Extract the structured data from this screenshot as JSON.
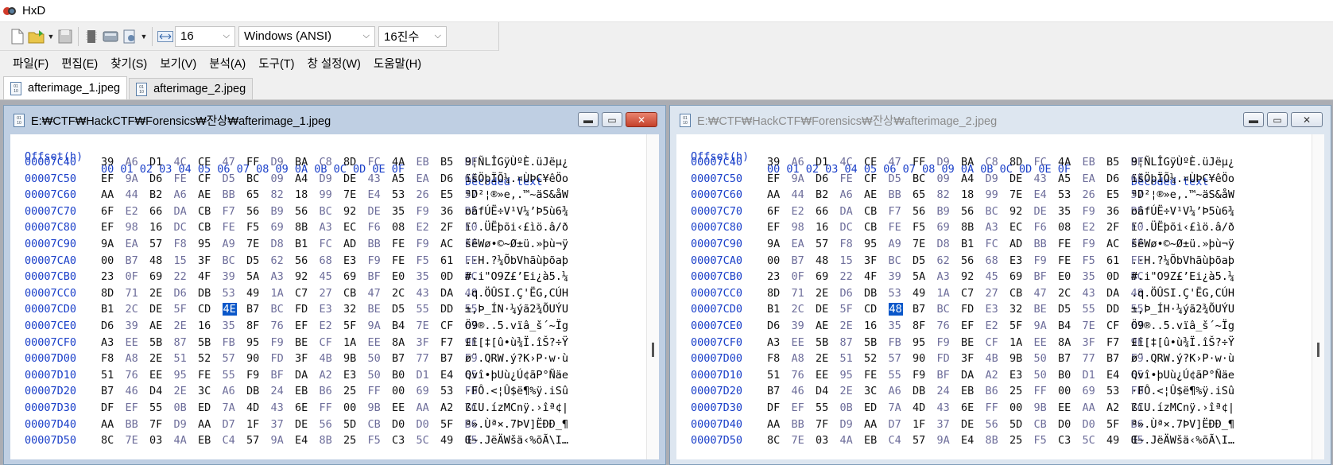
{
  "app": {
    "title": "HxD"
  },
  "toolbar": {
    "bytes_per_row": "16",
    "charset": "Windows (ANSI)",
    "offset_base": "16진수"
  },
  "menu": [
    "파일(F)",
    "편집(E)",
    "찾기(S)",
    "보기(V)",
    "분석(A)",
    "도구(T)",
    "창 설정(W)",
    "도움말(H)"
  ],
  "tabs": [
    {
      "label": "afterimage_1.jpeg"
    },
    {
      "label": "afterimage_2.jpeg"
    }
  ],
  "header": {
    "offset": "Offset(h)",
    "columns": "00 01 02 03 04 05 06 07 08 09 0A 0B 0C 0D 0E 0F",
    "decoded": "Decoded text"
  },
  "windows": [
    {
      "path": "E:₩CTF₩HackCTF₩Forensics₩잔상₩afterimage_1.jpeg",
      "selected_row": 9,
      "selected_col": 5,
      "rows": [
        {
          "offset": "00007C40",
          "bytes": [
            "39",
            "A6",
            "D1",
            "4C",
            "CE",
            "47",
            "FF",
            "D9",
            "BA",
            "C8",
            "8D",
            "FC",
            "4A",
            "EB",
            "B5",
            "BF"
          ],
          "text": "9¦ÑLÎGÿÙºÈ.üJëµ¿"
        },
        {
          "offset": "00007C50",
          "bytes": [
            "EF",
            "9A",
            "D6",
            "FE",
            "CF",
            "D5",
            "BC",
            "09",
            "A4",
            "D9",
            "DE",
            "43",
            "A5",
            "EA",
            "D6",
            "6F"
          ],
          "text": "ïšÖþÏÕ¼.¤ÙÞC¥êÖo"
        },
        {
          "offset": "00007C60",
          "bytes": [
            "AA",
            "44",
            "B2",
            "A6",
            "AE",
            "BB",
            "65",
            "82",
            "18",
            "99",
            "7E",
            "E4",
            "53",
            "26",
            "E5",
            "57"
          ],
          "text": "ªD²¦®»e‚.™~äS&åW"
        },
        {
          "offset": "00007C70",
          "bytes": [
            "6F",
            "E2",
            "66",
            "DA",
            "CB",
            "F7",
            "56",
            "B9",
            "56",
            "BC",
            "92",
            "DE",
            "35",
            "F9",
            "36",
            "BE"
          ],
          "text": "oâfÚË÷V¹V¼’Þ5ù6¾"
        },
        {
          "offset": "00007C80",
          "bytes": [
            "EF",
            "98",
            "16",
            "DC",
            "CB",
            "FE",
            "F5",
            "69",
            "8B",
            "A3",
            "EC",
            "F6",
            "08",
            "E2",
            "2F",
            "F0"
          ],
          "text": "ï˜.ÜËþõi‹£ìö.â/ð"
        },
        {
          "offset": "00007C90",
          "bytes": [
            "9A",
            "EA",
            "57",
            "F8",
            "95",
            "A9",
            "7E",
            "D8",
            "B1",
            "FC",
            "AD",
            "BB",
            "FE",
            "F9",
            "AC",
            "FF"
          ],
          "text": "šêWø•©~Ø±ü.»þù¬ÿ"
        },
        {
          "offset": "00007CA0",
          "bytes": [
            "00",
            "B7",
            "48",
            "15",
            "3F",
            "BC",
            "D5",
            "62",
            "56",
            "68",
            "E3",
            "F9",
            "FE",
            "F5",
            "61",
            "FE"
          ],
          "text": ".·H.?¼ÕbVhãùþõaþ"
        },
        {
          "offset": "00007CB0",
          "bytes": [
            "23",
            "0F",
            "69",
            "22",
            "4F",
            "39",
            "5A",
            "A3",
            "92",
            "45",
            "69",
            "BF",
            "E0",
            "35",
            "0D",
            "BC"
          ],
          "text": "#.i\"O9Z£’Ei¿à5.¼"
        },
        {
          "offset": "00007CC0",
          "bytes": [
            "8D",
            "71",
            "2E",
            "D6",
            "DB",
            "53",
            "49",
            "1A",
            "C7",
            "27",
            "CB",
            "47",
            "2C",
            "43",
            "DA",
            "48"
          ],
          "text": ".q.ÖÛSI.Ç'ËG,CÚH"
        },
        {
          "offset": "00007CD0",
          "bytes": [
            "B1",
            "2C",
            "DE",
            "5F",
            "CD",
            "4E",
            "B7",
            "BC",
            "FD",
            "E3",
            "32",
            "BE",
            "D5",
            "55",
            "DD",
            "55"
          ],
          "text": "±,Þ_ÍN·¼ýã2¾ÕUÝU"
        },
        {
          "offset": "00007CE0",
          "bytes": [
            "D6",
            "39",
            "AE",
            "2E",
            "16",
            "35",
            "8F",
            "76",
            "EF",
            "E2",
            "5F",
            "9A",
            "B4",
            "7E",
            "CF",
            "67"
          ],
          "text": "Ö9®..5.vïâ_š´~Ïg"
        },
        {
          "offset": "00007CF0",
          "bytes": [
            "A3",
            "EE",
            "5B",
            "87",
            "5B",
            "FB",
            "95",
            "F9",
            "BE",
            "CF",
            "1A",
            "EE",
            "8A",
            "3F",
            "F7",
            "9F"
          ],
          "text": "£î[‡[û•ù¾Ï.îŠ?÷Ÿ"
        },
        {
          "offset": "00007D00",
          "bytes": [
            "F8",
            "A8",
            "2E",
            "51",
            "52",
            "57",
            "90",
            "FD",
            "3F",
            "4B",
            "9B",
            "50",
            "B7",
            "77",
            "B7",
            "F9"
          ],
          "text": "ø¨.QRW.ý?K›P·w·ù"
        },
        {
          "offset": "00007D10",
          "bytes": [
            "51",
            "76",
            "EE",
            "95",
            "FE",
            "55",
            "F9",
            "BF",
            "DA",
            "A2",
            "E3",
            "50",
            "B0",
            "D1",
            "E4",
            "65"
          ],
          "text": "Qvî•þUù¿Ú¢ãP°Ñäe"
        },
        {
          "offset": "00007D20",
          "bytes": [
            "B7",
            "46",
            "D4",
            "2E",
            "3C",
            "A6",
            "DB",
            "24",
            "EB",
            "B6",
            "25",
            "FF",
            "00",
            "69",
            "53",
            "FB"
          ],
          "text": "·FÔ.<¦Û$ë¶%ÿ.iSû"
        },
        {
          "offset": "00007D30",
          "bytes": [
            "DF",
            "EF",
            "55",
            "0B",
            "ED",
            "7A",
            "4D",
            "43",
            "6E",
            "FF",
            "00",
            "9B",
            "EE",
            "AA",
            "A2",
            "7C"
          ],
          "text": "ßïU.ízMCnÿ.›îª¢|"
        },
        {
          "offset": "00007D40",
          "bytes": [
            "AA",
            "BB",
            "7F",
            "D9",
            "AA",
            "D7",
            "1F",
            "37",
            "DE",
            "56",
            "5D",
            "CB",
            "D0",
            "D0",
            "5F",
            "B6"
          ],
          "text": "ª».Ùª×.7ÞV]ËÐÐ_¶"
        },
        {
          "offset": "00007D50",
          "bytes": [
            "8C",
            "7E",
            "03",
            "4A",
            "EB",
            "C4",
            "57",
            "9A",
            "E4",
            "8B",
            "25",
            "F5",
            "C3",
            "5C",
            "49",
            "85"
          ],
          "text": "Œ~.JëÄWšä‹%õÃ\\I…"
        }
      ]
    },
    {
      "path": "E:₩CTF₩HackCTF₩Forensics₩잔상₩afterimage_2.jpeg",
      "selected_row": 9,
      "selected_col": 5,
      "rows": [
        {
          "offset": "00007C40",
          "bytes": [
            "39",
            "A6",
            "D1",
            "4C",
            "CE",
            "47",
            "FF",
            "D9",
            "BA",
            "C8",
            "8D",
            "FC",
            "4A",
            "EB",
            "B5",
            "BF"
          ],
          "text": "9¦ÑLÎGÿÙºÈ.üJëµ¿"
        },
        {
          "offset": "00007C50",
          "bytes": [
            "EF",
            "9A",
            "D6",
            "FE",
            "CF",
            "D5",
            "BC",
            "09",
            "A4",
            "D9",
            "DE",
            "43",
            "A5",
            "EA",
            "D6",
            "6F"
          ],
          "text": "ïšÖþÏÕ¼.¤ÙÞC¥êÖo"
        },
        {
          "offset": "00007C60",
          "bytes": [
            "AA",
            "44",
            "B2",
            "A6",
            "AE",
            "BB",
            "65",
            "82",
            "18",
            "99",
            "7E",
            "E4",
            "53",
            "26",
            "E5",
            "57"
          ],
          "text": "ªD²¦®»e‚.™~äS&åW"
        },
        {
          "offset": "00007C70",
          "bytes": [
            "6F",
            "E2",
            "66",
            "DA",
            "CB",
            "F7",
            "56",
            "B9",
            "56",
            "BC",
            "92",
            "DE",
            "35",
            "F9",
            "36",
            "BE"
          ],
          "text": "oâfÚË÷V¹V¼’Þ5ù6¾"
        },
        {
          "offset": "00007C80",
          "bytes": [
            "EF",
            "98",
            "16",
            "DC",
            "CB",
            "FE",
            "F5",
            "69",
            "8B",
            "A3",
            "EC",
            "F6",
            "08",
            "E2",
            "2F",
            "F0"
          ],
          "text": "ï˜.ÜËþõi‹£ìö.â/ð"
        },
        {
          "offset": "00007C90",
          "bytes": [
            "9A",
            "EA",
            "57",
            "F8",
            "95",
            "A9",
            "7E",
            "D8",
            "B1",
            "FC",
            "AD",
            "BB",
            "FE",
            "F9",
            "AC",
            "FF"
          ],
          "text": "šêWø•©~Ø±ü.»þù¬ÿ"
        },
        {
          "offset": "00007CA0",
          "bytes": [
            "00",
            "B7",
            "48",
            "15",
            "3F",
            "BC",
            "D5",
            "62",
            "56",
            "68",
            "E3",
            "F9",
            "FE",
            "F5",
            "61",
            "FE"
          ],
          "text": ".·H.?¼ÕbVhãùþõaþ"
        },
        {
          "offset": "00007CB0",
          "bytes": [
            "23",
            "0F",
            "69",
            "22",
            "4F",
            "39",
            "5A",
            "A3",
            "92",
            "45",
            "69",
            "BF",
            "E0",
            "35",
            "0D",
            "BC"
          ],
          "text": "#.i\"O9Z£’Ei¿à5.¼"
        },
        {
          "offset": "00007CC0",
          "bytes": [
            "8D",
            "71",
            "2E",
            "D6",
            "DB",
            "53",
            "49",
            "1A",
            "C7",
            "27",
            "CB",
            "47",
            "2C",
            "43",
            "DA",
            "48"
          ],
          "text": ".q.ÖÛSI.Ç'ËG,CÚH"
        },
        {
          "offset": "00007CD0",
          "bytes": [
            "B1",
            "2C",
            "DE",
            "5F",
            "CD",
            "48",
            "B7",
            "BC",
            "FD",
            "E3",
            "32",
            "BE",
            "D5",
            "55",
            "DD",
            "55"
          ],
          "text": "±,Þ_ÍH·¼ýã2¾ÕUÝU"
        },
        {
          "offset": "00007CE0",
          "bytes": [
            "D6",
            "39",
            "AE",
            "2E",
            "16",
            "35",
            "8F",
            "76",
            "EF",
            "E2",
            "5F",
            "9A",
            "B4",
            "7E",
            "CF",
            "67"
          ],
          "text": "Ö9®..5.vïâ_š´~Ïg"
        },
        {
          "offset": "00007CF0",
          "bytes": [
            "A3",
            "EE",
            "5B",
            "87",
            "5B",
            "FB",
            "95",
            "F9",
            "BE",
            "CF",
            "1A",
            "EE",
            "8A",
            "3F",
            "F7",
            "9F"
          ],
          "text": "£î[‡[û•ù¾Ï.îŠ?÷Ÿ"
        },
        {
          "offset": "00007D00",
          "bytes": [
            "F8",
            "A8",
            "2E",
            "51",
            "52",
            "57",
            "90",
            "FD",
            "3F",
            "4B",
            "9B",
            "50",
            "B7",
            "77",
            "B7",
            "F9"
          ],
          "text": "ø¨.QRW.ý?K›P·w·ù"
        },
        {
          "offset": "00007D10",
          "bytes": [
            "51",
            "76",
            "EE",
            "95",
            "FE",
            "55",
            "F9",
            "BF",
            "DA",
            "A2",
            "E3",
            "50",
            "B0",
            "D1",
            "E4",
            "65"
          ],
          "text": "Qvî•þUù¿Ú¢ãP°Ñäe"
        },
        {
          "offset": "00007D20",
          "bytes": [
            "B7",
            "46",
            "D4",
            "2E",
            "3C",
            "A6",
            "DB",
            "24",
            "EB",
            "B6",
            "25",
            "FF",
            "00",
            "69",
            "53",
            "FB"
          ],
          "text": "·FÔ.<¦Û$ë¶%ÿ.iSû"
        },
        {
          "offset": "00007D30",
          "bytes": [
            "DF",
            "EF",
            "55",
            "0B",
            "ED",
            "7A",
            "4D",
            "43",
            "6E",
            "FF",
            "00",
            "9B",
            "EE",
            "AA",
            "A2",
            "7C"
          ],
          "text": "ßïU.ízMCnÿ.›îª¢|"
        },
        {
          "offset": "00007D40",
          "bytes": [
            "AA",
            "BB",
            "7F",
            "D9",
            "AA",
            "D7",
            "1F",
            "37",
            "DE",
            "56",
            "5D",
            "CB",
            "D0",
            "D0",
            "5F",
            "B6"
          ],
          "text": "ª».Ùª×.7ÞV]ËÐÐ_¶"
        },
        {
          "offset": "00007D50",
          "bytes": [
            "8C",
            "7E",
            "03",
            "4A",
            "EB",
            "C4",
            "57",
            "9A",
            "E4",
            "8B",
            "25",
            "F5",
            "C3",
            "5C",
            "49",
            "85"
          ],
          "text": "Œ~.JëÄWšä‹%õÃ\\I…"
        }
      ]
    }
  ],
  "colors": {
    "accent_blue": "#1a3fc9",
    "selection": "#0a57c9",
    "close_red": "#c5412b"
  }
}
